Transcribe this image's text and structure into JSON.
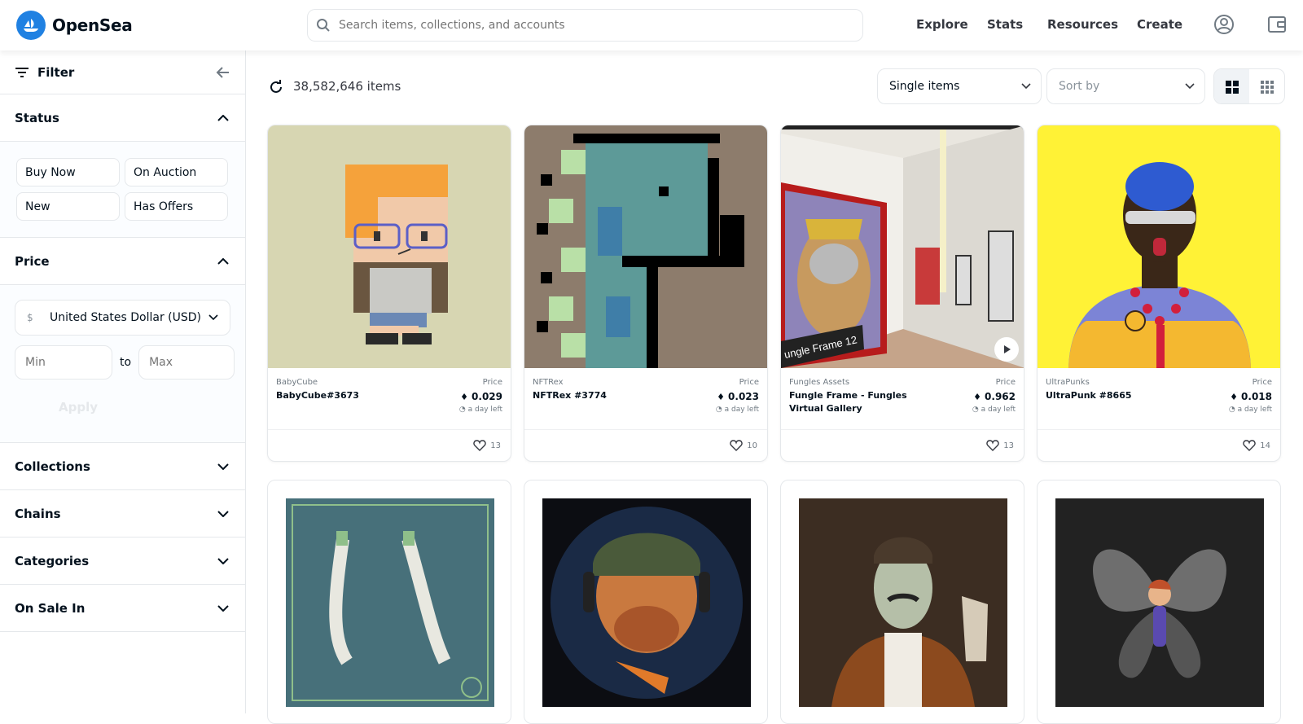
{
  "header": {
    "logo_text": "OpenSea",
    "search_placeholder": "Search items, collections, and accounts",
    "nav": [
      "Explore",
      "Stats",
      "Resources",
      "Create"
    ],
    "brand_color": "#2081e2"
  },
  "sidebar": {
    "filter_label": "Filter",
    "status": {
      "title": "Status",
      "options": [
        "Buy Now",
        "On Auction",
        "New",
        "Has Offers"
      ]
    },
    "price": {
      "title": "Price",
      "currency_symbol": "$",
      "currency": "United States Dollar (USD)",
      "min_placeholder": "Min",
      "to_label": "to",
      "max_placeholder": "Max",
      "apply_label": "Apply"
    },
    "sections": [
      "Collections",
      "Chains",
      "Categories",
      "On Sale In"
    ]
  },
  "main": {
    "item_count": "38,582,646 items",
    "type_select": "Single items",
    "sort_select": "Sort by",
    "cards": [
      {
        "collection": "BabyCube",
        "name": "BabyCube#3673",
        "price_label": "Price",
        "price": "0.029",
        "time_left": "a day left",
        "likes": "13"
      },
      {
        "collection": "NFTRex",
        "name": "NFTRex #3774",
        "price_label": "Price",
        "price": "0.023",
        "time_left": "a day left",
        "likes": "10"
      },
      {
        "collection": "Fungles Assets",
        "name": "Fungle Frame - Fungles Virtual Gallery",
        "price_label": "Price",
        "price": "0.962",
        "time_left": "a day left",
        "likes": "13",
        "image_caption": "ungle Frame 12"
      },
      {
        "collection": "UltraPunks",
        "name": "UltraPunk #8665",
        "price_label": "Price",
        "price": "0.018",
        "time_left": "a day left",
        "likes": "14"
      }
    ]
  }
}
